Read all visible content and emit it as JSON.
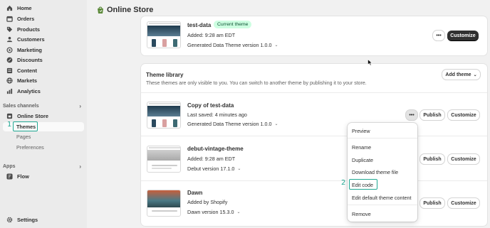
{
  "sidebar": {
    "items": [
      {
        "label": "Home",
        "icon": "home-icon"
      },
      {
        "label": "Orders",
        "icon": "orders-icon"
      },
      {
        "label": "Products",
        "icon": "tag-icon"
      },
      {
        "label": "Customers",
        "icon": "person-icon"
      },
      {
        "label": "Marketing",
        "icon": "target-icon"
      },
      {
        "label": "Discounts",
        "icon": "discount-icon"
      },
      {
        "label": "Content",
        "icon": "content-icon"
      },
      {
        "label": "Markets",
        "icon": "globe-icon"
      },
      {
        "label": "Analytics",
        "icon": "chart-icon"
      }
    ],
    "sales_channels_label": "Sales channels",
    "online_store": "Online Store",
    "sub_items": [
      {
        "label": "Themes",
        "active": true
      },
      {
        "label": "Pages"
      },
      {
        "label": "Preferences"
      }
    ],
    "apps_label": "Apps",
    "flow": "Flow",
    "settings": "Settings",
    "step1": "1"
  },
  "header": {
    "title": "Online Store"
  },
  "current_theme": {
    "name": "test-data",
    "badge": "Current theme",
    "added": "Added: 9:28 am EDT",
    "version": "Generated Data Theme version 1.0.0",
    "customize": "Customize"
  },
  "library": {
    "title": "Theme library",
    "subtitle": "These themes are only visible to you. You can switch to another theme by publishing it to your store.",
    "add_theme": "Add theme",
    "themes": [
      {
        "name": "Copy of test-data",
        "meta": "Last saved: 4 minutes ago",
        "version": "Generated Data Theme version 1.0.0"
      },
      {
        "name": "debut-vintage-theme",
        "meta": "Added: 9:28 am EDT",
        "version": "Debut version 17.1.0"
      },
      {
        "name": "Dawn",
        "meta": "Added by Shopify",
        "version": "Dawn version 15.3.0"
      }
    ],
    "publish": "Publish",
    "customize": "Customize"
  },
  "menu": {
    "items": [
      "Preview",
      "Rename",
      "Duplicate",
      "Download theme file",
      "Edit code",
      "Edit default theme content",
      "Remove"
    ],
    "step2": "2"
  },
  "colors": {
    "accent": "#21a893",
    "dark_button": "#303030",
    "badge_bg": "#cdfee1"
  }
}
